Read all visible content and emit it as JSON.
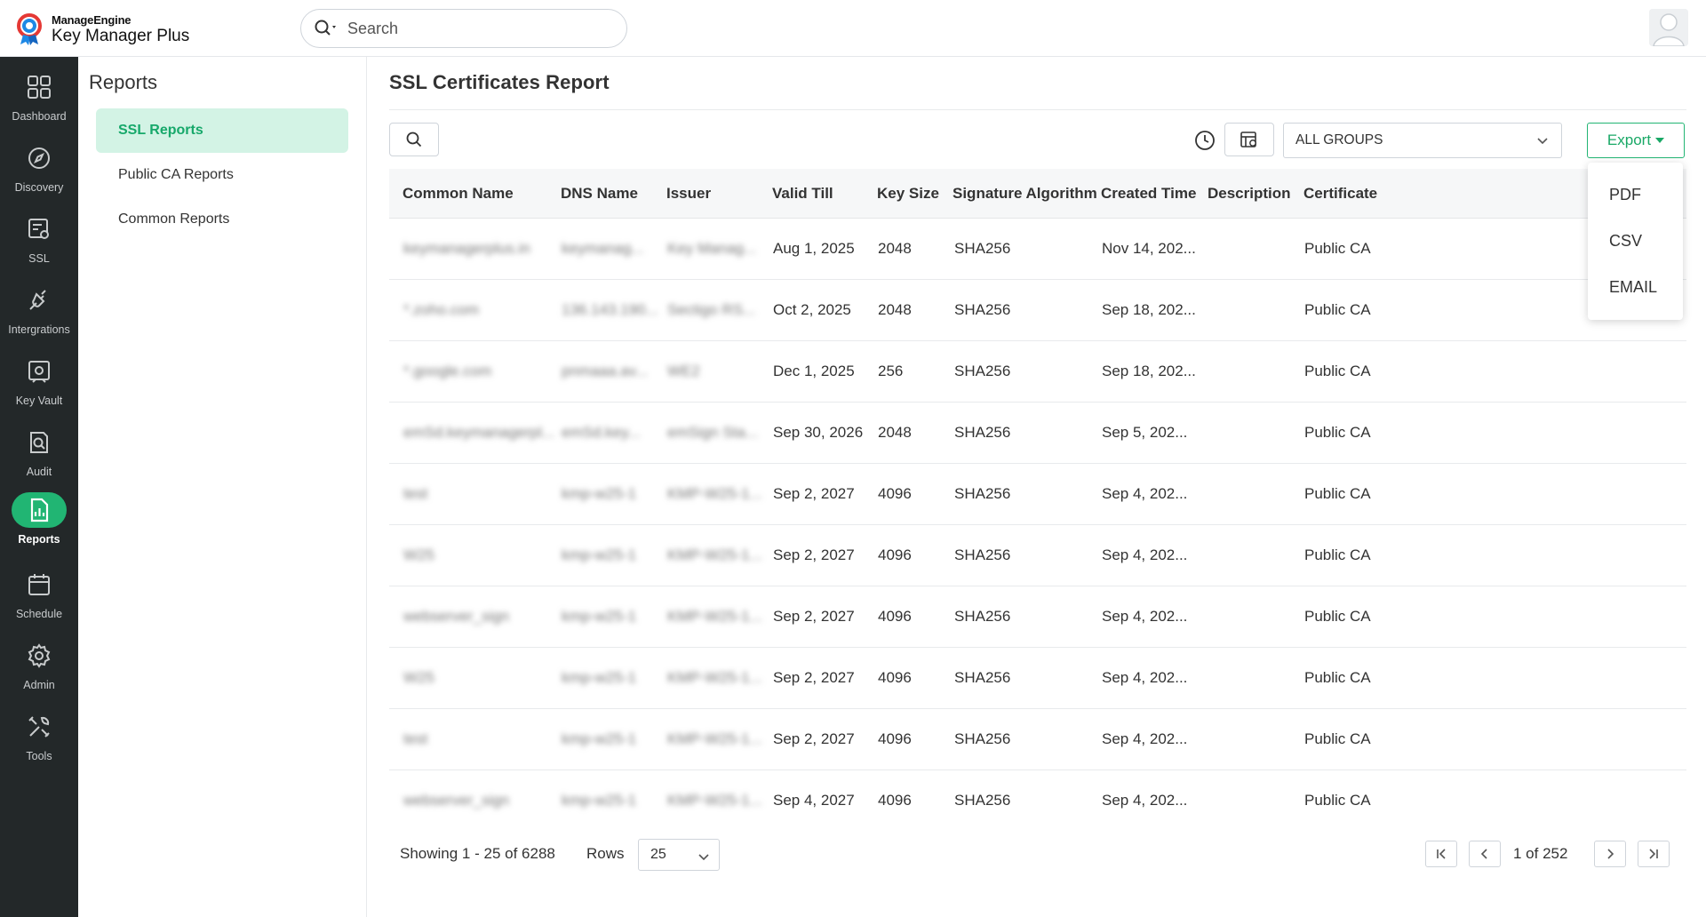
{
  "header": {
    "logo_brand": "ManageEngine",
    "logo_product": "Key Manager Plus",
    "search_placeholder": "Search"
  },
  "leftnav": [
    {
      "label": "Dashboard",
      "icon": "dashboard-icon"
    },
    {
      "label": "Discovery",
      "icon": "compass-icon"
    },
    {
      "label": "SSL",
      "icon": "certificate-icon"
    },
    {
      "label": "Intergrations",
      "icon": "plug-icon"
    },
    {
      "label": "Key Vault",
      "icon": "vault-icon"
    },
    {
      "label": "Audit",
      "icon": "audit-icon"
    },
    {
      "label": "Reports",
      "icon": "report-icon",
      "active": true
    },
    {
      "label": "Schedule",
      "icon": "calendar-icon"
    },
    {
      "label": "Admin",
      "icon": "gear-icon"
    },
    {
      "label": "Tools",
      "icon": "tools-icon"
    }
  ],
  "subnav": {
    "title": "Reports",
    "items": [
      {
        "label": "SSL Reports",
        "active": true
      },
      {
        "label": "Public CA Reports"
      },
      {
        "label": "Common Reports"
      }
    ]
  },
  "main": {
    "title": "SSL Certificates Report",
    "group_select": "ALL GROUPS",
    "export_label": "Export",
    "export_menu": [
      "PDF",
      "CSV",
      "EMAIL"
    ],
    "accent_color": "#21b573"
  },
  "table": {
    "columns": [
      "Common Name",
      "DNS Name",
      "Issuer",
      "Valid Till",
      "Key Size",
      "Signature Algorithm",
      "Created Time",
      "Description",
      "Certificate"
    ],
    "rows": [
      [
        "keymanagerplus.in",
        "keymanag...",
        "Key Manag...",
        "Aug 1, 2025",
        "2048",
        "SHA256",
        "Nov 14, 202...",
        "",
        "Public CA"
      ],
      [
        "*.zoho.com",
        "136.143.190...",
        "Sectigo RS...",
        "Oct 2, 2025",
        "2048",
        "SHA256",
        "Sep 18, 202...",
        "",
        "Public CA"
      ],
      [
        "*.google.com",
        "pnmaaa.av...",
        "WE2",
        "Dec 1, 2025",
        "256",
        "SHA256",
        "Sep 18, 202...",
        "",
        "Public CA"
      ],
      [
        "emSd.keymanagerpl...",
        "emSd.key...",
        "emSign Sta...",
        "Sep 30, 2026",
        "2048",
        "SHA256",
        "Sep 5, 202...",
        "",
        "Public CA"
      ],
      [
        "test",
        "kmp-w25-1",
        "KMP-W25-1...",
        "Sep 2, 2027",
        "4096",
        "SHA256",
        "Sep 4, 202...",
        "",
        "Public CA"
      ],
      [
        "W25",
        "kmp-w25-1",
        "KMP-W25-1...",
        "Sep 2, 2027",
        "4096",
        "SHA256",
        "Sep 4, 202...",
        "",
        "Public CA"
      ],
      [
        "webserver_sign",
        "kmp-w25-1",
        "KMP-W25-1...",
        "Sep 2, 2027",
        "4096",
        "SHA256",
        "Sep 4, 202...",
        "",
        "Public CA"
      ],
      [
        "W25",
        "kmp-w25-1",
        "KMP-W25-1...",
        "Sep 2, 2027",
        "4096",
        "SHA256",
        "Sep 4, 202...",
        "",
        "Public CA"
      ],
      [
        "test",
        "kmp-w25-1",
        "KMP-W25-1...",
        "Sep 2, 2027",
        "4096",
        "SHA256",
        "Sep 4, 202...",
        "",
        "Public CA"
      ],
      [
        "webserver_sign",
        "kmp-w25-1",
        "KMP-W25-1...",
        "Sep 4, 2027",
        "4096",
        "SHA256",
        "Sep 4, 202...",
        "",
        "Public CA"
      ]
    ]
  },
  "pagination": {
    "showing": "Showing 1 - 25 of 6288",
    "rows_label": "Rows",
    "rows_value": "25",
    "page_text": "1 of 252"
  }
}
